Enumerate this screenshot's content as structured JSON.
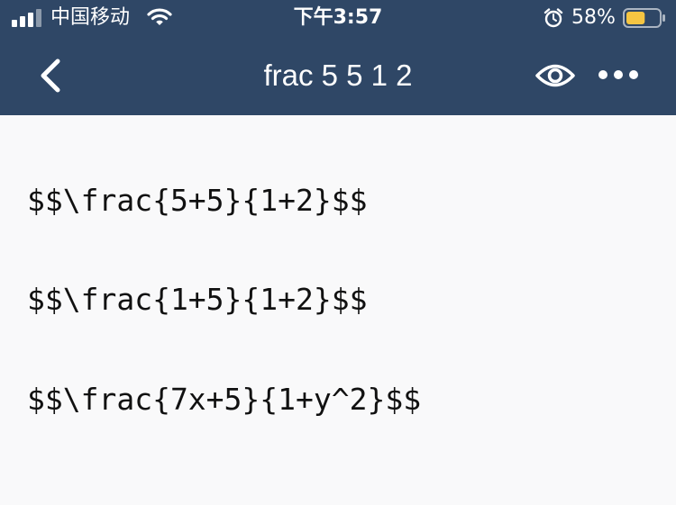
{
  "status_bar": {
    "carrier": "中国移动",
    "time": "下午3:57",
    "battery_percent": "58%",
    "battery_level": 0.58,
    "battery_color": "#f5c542",
    "icons": [
      "signal-icon",
      "wifi-icon",
      "alarm-icon",
      "battery-icon"
    ]
  },
  "nav": {
    "title": "frac 5 5 1 2",
    "icons": [
      "back-chevron-icon",
      "eye-icon",
      "more-icon"
    ]
  },
  "colors": {
    "header_bg": "#2f4766",
    "content_bg": "#f9f9fa",
    "text": "#111111"
  },
  "content": {
    "lines": [
      "$$\\frac{5+5}{1+2}$$",
      "$$\\frac{1+5}{1+2}$$",
      "$$\\frac{7x+5}{1+y^2}$$"
    ]
  }
}
